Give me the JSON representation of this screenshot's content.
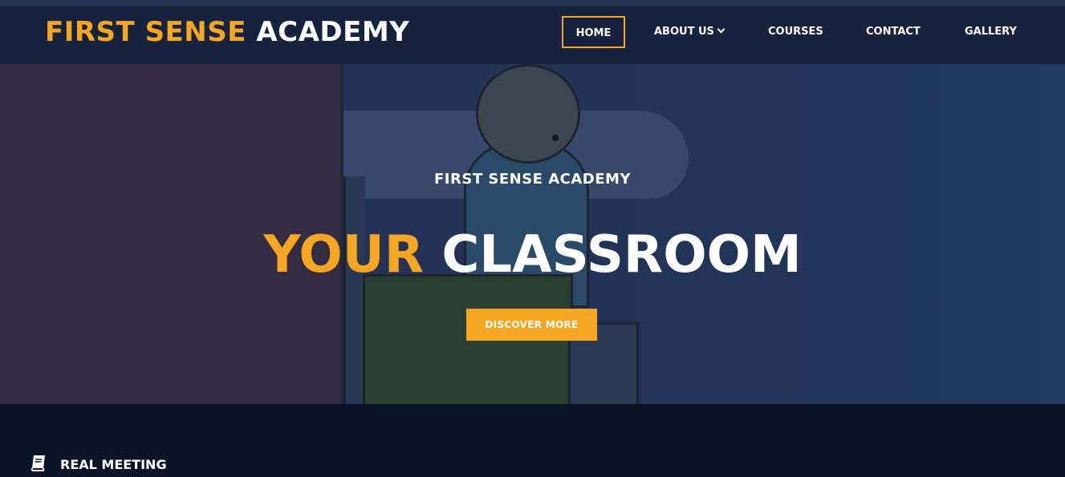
{
  "brand": {
    "accent_text": "FIRST SENSE",
    "rest_text": "ACADEMY",
    "accent_color": "#f5a623"
  },
  "nav": {
    "items": [
      {
        "label": "HOME",
        "active": true
      },
      {
        "label": "ABOUT US",
        "has_dropdown": true
      },
      {
        "label": "COURSES"
      },
      {
        "label": "CONTACT"
      },
      {
        "label": "GALLERY"
      }
    ]
  },
  "hero": {
    "subtitle": "FIRST SENSE ACADEMY",
    "title_accent": "YOUR",
    "title_rest": "CLASSROOM",
    "cta_label": "DISCOVER MORE"
  },
  "features": {
    "items": [
      {
        "icon": "book-icon",
        "label": "REAL MEETING"
      }
    ]
  }
}
